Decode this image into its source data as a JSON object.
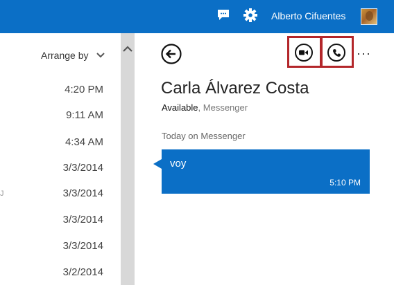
{
  "topbar": {
    "user_name": "Alberto Cifuentes",
    "accent": "#0b6fc6",
    "icons": [
      "chat-icon",
      "gear-icon"
    ]
  },
  "message_list": {
    "arrange_label": "Arrange by",
    "times": [
      "4:20 PM",
      "9:11 AM",
      "4:34 AM",
      "3/3/2014",
      "3/3/2014",
      "3/3/2014",
      "3/3/2014",
      "3/2/2014"
    ],
    "clipped_letter": "J"
  },
  "conversation": {
    "contact_name": "Carla Álvarez Costa",
    "status": "Available",
    "service": ", Messenger",
    "day_header": "Today on Messenger",
    "message": {
      "text": "voy",
      "time": "5:10 PM"
    },
    "more_label": "···",
    "highlight_color": "#b3262a"
  }
}
